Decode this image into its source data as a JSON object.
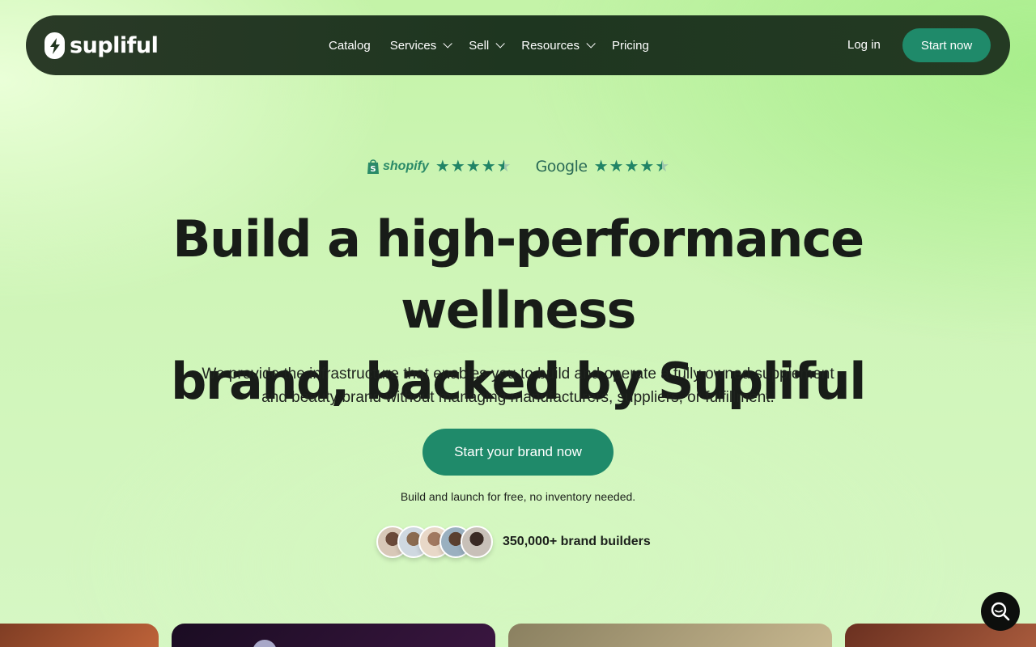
{
  "brand": {
    "name": "supliful"
  },
  "nav": {
    "items": [
      {
        "label": "Catalog",
        "has_dropdown": false
      },
      {
        "label": "Services",
        "has_dropdown": true
      },
      {
        "label": "Sell",
        "has_dropdown": true
      },
      {
        "label": "Resources",
        "has_dropdown": true
      },
      {
        "label": "Pricing",
        "has_dropdown": false
      }
    ],
    "login_label": "Log in",
    "start_label": "Start now"
  },
  "ratings": [
    {
      "platform": "shopify",
      "stars": 4.5
    },
    {
      "platform": "Google",
      "stars": 4.5
    }
  ],
  "hero": {
    "headline_line1": "Build a high-performance wellness",
    "headline_line2": "brand, backed by Supliful",
    "subtext_line1": "We provide the infrastructure that enables you to build and operate a fully owned supplement",
    "subtext_line2": "and beauty brand without managing manufacturers, suppliers, or fulfillment.",
    "cta_label": "Start your brand now",
    "note": "Build and launch for free, no inventory needed.",
    "builders_label": "350,000+ brand builders"
  },
  "colors": {
    "accent": "#1f8a6a",
    "nav_bg": "#22361f",
    "star": "#218466"
  }
}
